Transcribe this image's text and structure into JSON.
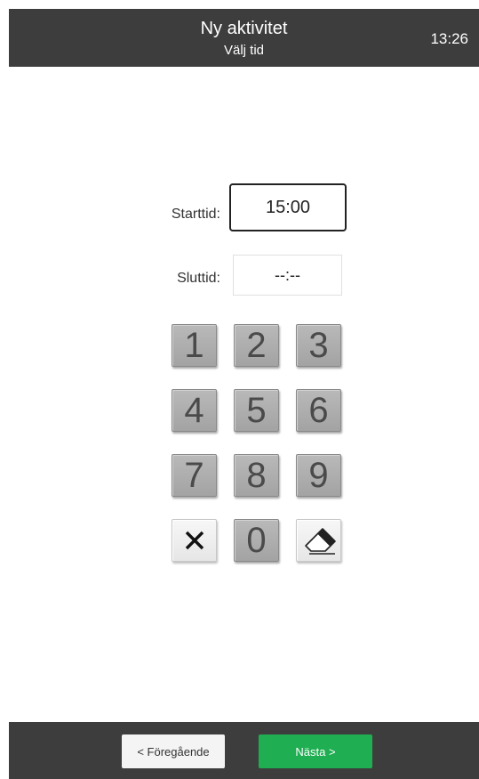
{
  "header": {
    "title": "Ny aktivitet",
    "subtitle": "Välj tid",
    "clock": "13:26"
  },
  "form": {
    "start_label": "Starttid:",
    "start_value": "15:00",
    "end_label": "Sluttid:",
    "end_value": "--:--"
  },
  "keypad": {
    "digits": [
      "1",
      "2",
      "3",
      "4",
      "5",
      "6",
      "7",
      "8",
      "9",
      "0"
    ],
    "clear_icon": "close-icon",
    "erase_icon": "eraser-icon"
  },
  "footer": {
    "prev_label": "< Föregående",
    "next_label": "Nästa >"
  },
  "colors": {
    "header_bg": "#3d3d3d",
    "next_button": "#1fae52",
    "key_gray": "#afafaf"
  }
}
